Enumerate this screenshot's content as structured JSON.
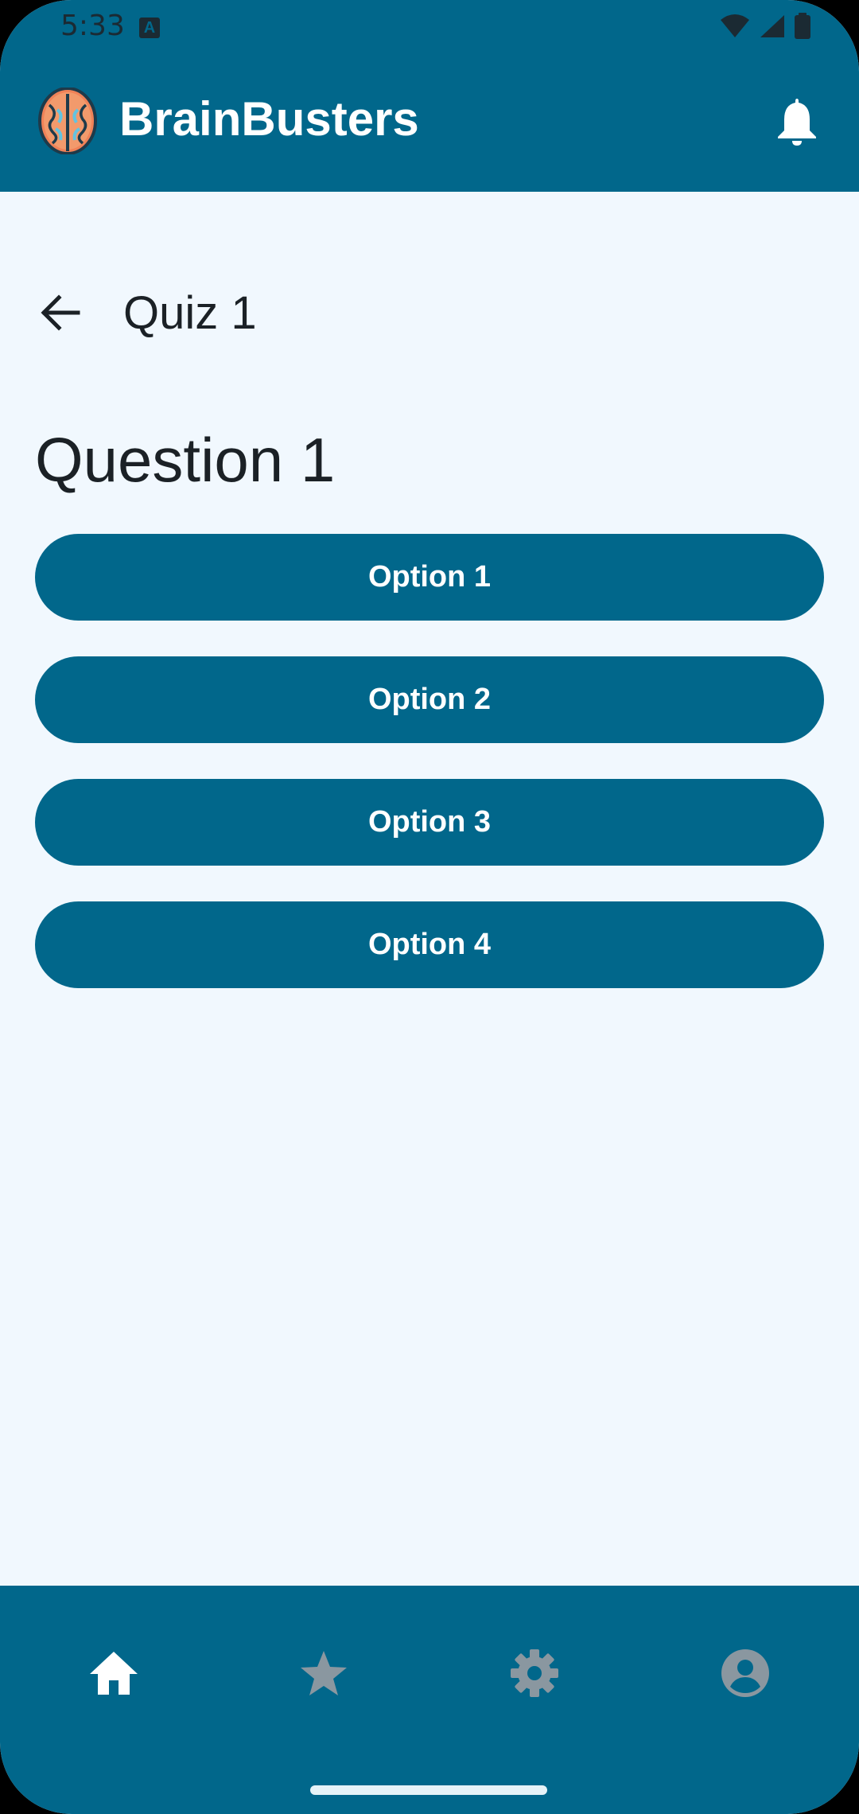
{
  "status_bar": {
    "time": "5:33",
    "indicator_letter": "A"
  },
  "app_bar": {
    "title": "BrainBusters"
  },
  "screen": {
    "title": "Quiz 1",
    "question": "Question 1",
    "options": [
      "Option 1",
      "Option 2",
      "Option 3",
      "Option 4"
    ]
  },
  "bottom_nav": {
    "items": [
      {
        "icon": "home-icon",
        "active": true
      },
      {
        "icon": "star-icon",
        "active": false
      },
      {
        "icon": "gear-icon",
        "active": false
      },
      {
        "icon": "account-icon",
        "active": false
      }
    ]
  },
  "colors": {
    "primary": "#01678b",
    "background": "#f1f8fe",
    "on_primary": "#ffffff",
    "inactive_icon": "#8a97a0"
  }
}
